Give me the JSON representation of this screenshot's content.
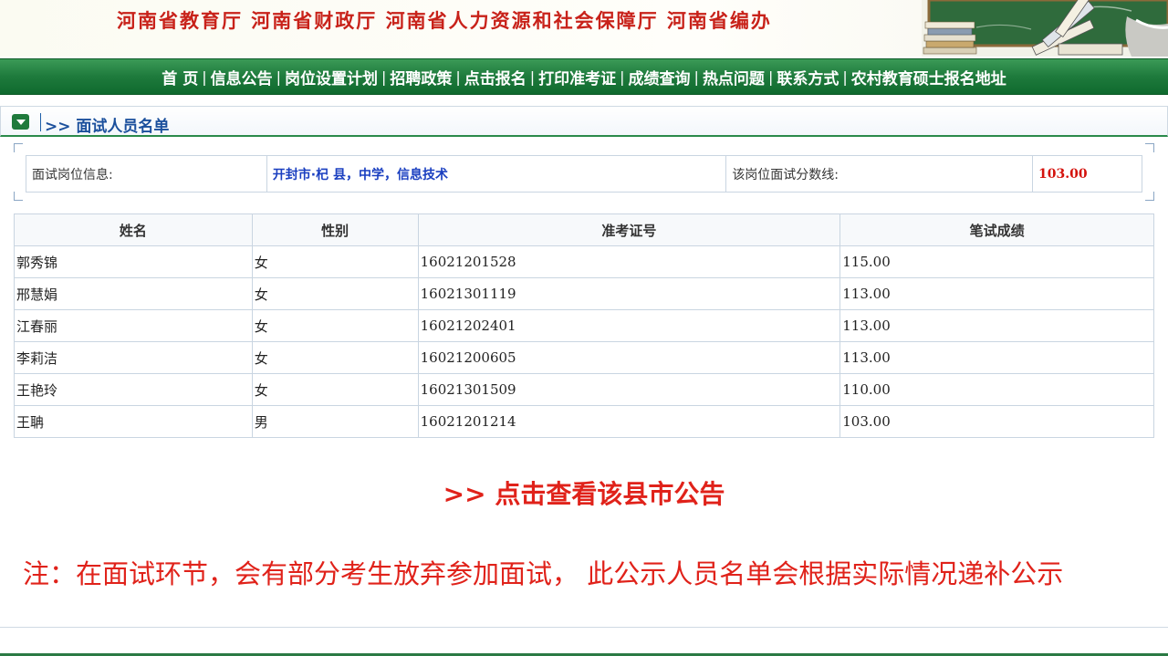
{
  "banner": {
    "title": "河南省教育厅  河南省财政厅  河南省人力资源和社会保障厅  河南省编办"
  },
  "nav": {
    "items": [
      {
        "label": "首 页"
      },
      {
        "label": "信息公告"
      },
      {
        "label": "岗位设置计划"
      },
      {
        "label": "招聘政策"
      },
      {
        "label": "点击报名"
      },
      {
        "label": "打印准考证"
      },
      {
        "label": "成绩查询"
      },
      {
        "label": "热点问题"
      },
      {
        "label": "联系方式"
      },
      {
        "label": "农村教育硕士报名地址"
      }
    ]
  },
  "section": {
    "title": ">> 面试人员名单"
  },
  "info": {
    "position_label": "面试岗位信息:",
    "position_value": "开封市·杞 县，中学，信息技术",
    "cutoff_label": "该岗位面试分数线:",
    "cutoff_value": "103.00"
  },
  "table": {
    "headers": {
      "name": "姓名",
      "gender": "性别",
      "ticket": "准考证号",
      "score": "笔试成绩"
    },
    "rows": [
      {
        "name": "郭秀锦",
        "gender": "女",
        "ticket": "16021201528",
        "score": "115.00"
      },
      {
        "name": "邢慧娟",
        "gender": "女",
        "ticket": "16021301119",
        "score": "113.00"
      },
      {
        "name": "江春丽",
        "gender": "女",
        "ticket": "16021202401",
        "score": "113.00"
      },
      {
        "name": "李莉洁",
        "gender": "女",
        "ticket": "16021200605",
        "score": "113.00"
      },
      {
        "name": "王艳玲",
        "gender": "女",
        "ticket": "16021301509",
        "score": "110.00"
      },
      {
        "name": "王聃",
        "gender": "男",
        "ticket": "16021201214",
        "score": "103.00"
      }
    ]
  },
  "footer": {
    "notice_link": ">> 点击查看该县市公告",
    "note": "注：在面试环节，会有部分考生放弃参加面试， 此公示人员名单会根据实际情况递补公示"
  },
  "colors": {
    "nav_green": "#1e7a3c",
    "banner_red": "#c8221a",
    "link_blue": "#1a3fc0",
    "notice_red": "#e0221a"
  }
}
